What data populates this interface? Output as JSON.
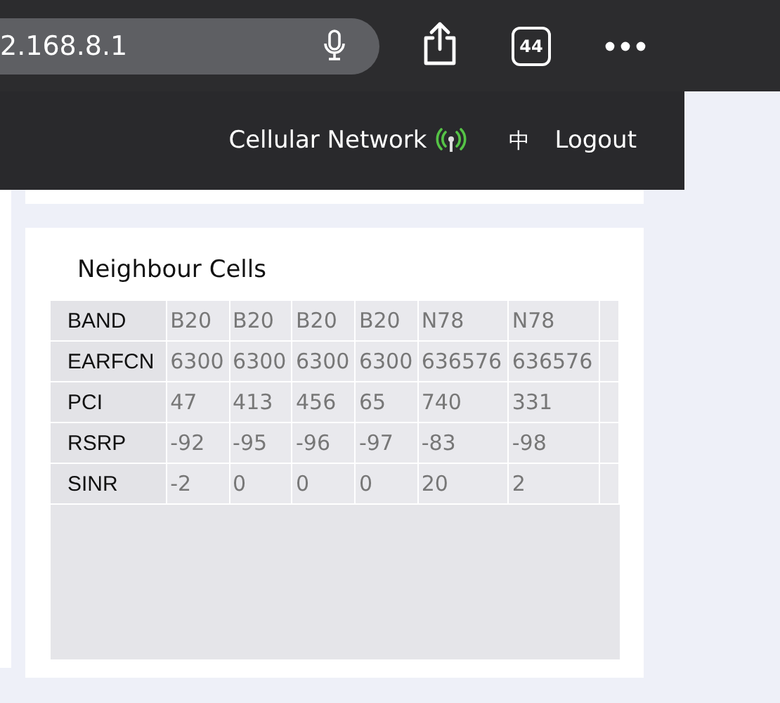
{
  "browser": {
    "address": "2.168.8.1",
    "tab_count": "44"
  },
  "header": {
    "network": "Cellular Network",
    "language": "中",
    "logout": "Logout"
  },
  "neighbour_cells": {
    "title": "Neighbour Cells",
    "rows": [
      {
        "label": "BAND",
        "values": [
          "B20",
          "B20",
          "B20",
          "B20",
          "N78",
          "N78"
        ]
      },
      {
        "label": "EARFCN",
        "values": [
          "6300",
          "6300",
          "6300",
          "6300",
          "636576",
          "636576"
        ]
      },
      {
        "label": "PCI",
        "values": [
          "47",
          "413",
          "456",
          "65",
          "740",
          "331"
        ]
      },
      {
        "label": "RSRP",
        "values": [
          "-92",
          "-95",
          "-96",
          "-97",
          "-83",
          "-98"
        ]
      },
      {
        "label": "SINR",
        "values": [
          "-2",
          "0",
          "0",
          "0",
          "20",
          "2"
        ]
      }
    ]
  }
}
